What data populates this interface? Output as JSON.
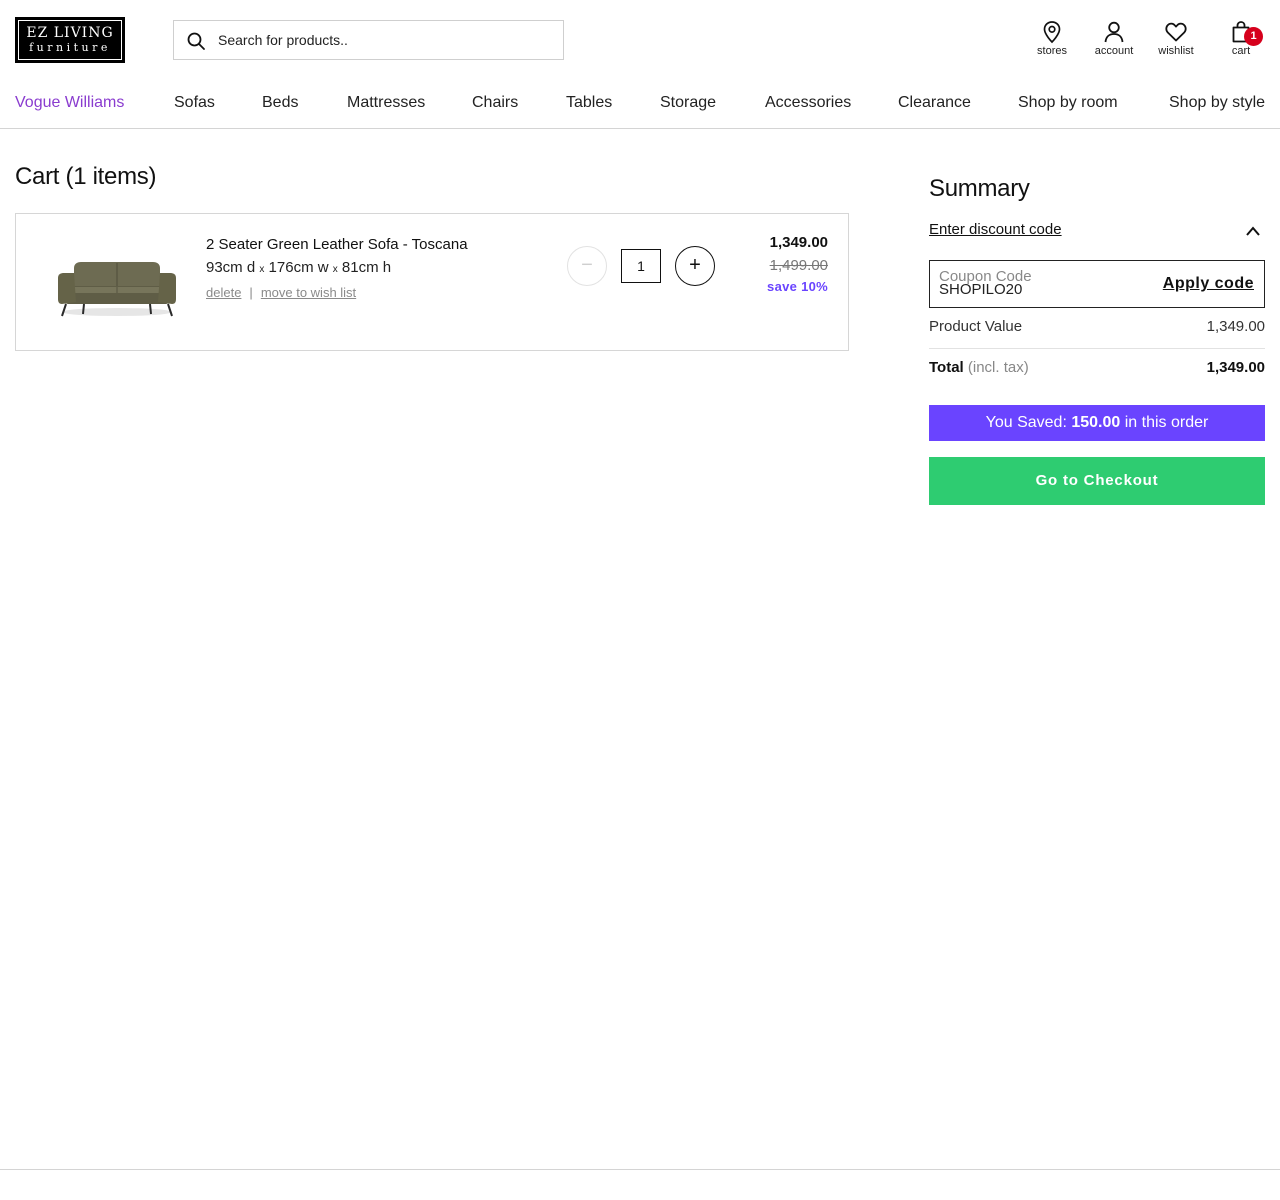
{
  "header": {
    "logo": {
      "line1": "EZ LIVING",
      "line2": "furniture"
    },
    "search": {
      "placeholder": "Search for products..",
      "icon": "search-icon"
    },
    "icons": [
      {
        "label": "stores",
        "icon": "location-pin-icon"
      },
      {
        "label": "account",
        "icon": "user-icon"
      },
      {
        "label": "wishlist",
        "icon": "heart-icon"
      },
      {
        "label": "cart",
        "icon": "shopping-bag-icon",
        "badge": "1"
      }
    ]
  },
  "nav": {
    "items": [
      "Vogue Williams",
      "Sofas",
      "Beds",
      "Mattresses",
      "Chairs",
      "Tables",
      "Storage",
      "Accessories",
      "Clearance",
      "Shop by room",
      "Shop by style"
    ],
    "accent_color": "#8a3ccf"
  },
  "cart": {
    "title": "Cart (1 items)",
    "item": {
      "name": "2 Seater Green Leather Sofa - Toscana",
      "dims": {
        "d": "93cm d",
        "w": "176cm w",
        "h": "81cm h",
        "sep": "x"
      },
      "links": {
        "delete": "delete",
        "sep": "|",
        "wishlist": "move to wish list"
      },
      "qty": {
        "minus": "−",
        "value": "1",
        "plus": "+"
      },
      "price_now": "1,349.00",
      "price_was": "1,499.00",
      "save": "save 10%"
    }
  },
  "summary": {
    "title": "Summary",
    "discount_toggle": "Enter discount code",
    "coupon": {
      "label": "Coupon Code",
      "value": "SHOPILO20",
      "apply": "Apply code"
    },
    "product_value": {
      "label": "Product Value",
      "value": "1,349.00"
    },
    "total": {
      "label": "Total",
      "suffix": "(incl. tax)",
      "value": "1,349.00"
    },
    "saved": {
      "prefix": "You Saved:",
      "amount": "150.00",
      "suffix": "in this order"
    },
    "checkout": "Go to Checkout",
    "colors": {
      "saved_bg": "#6a44ff",
      "checkout_bg": "#2ecc71",
      "badge": "#d6001c"
    }
  }
}
